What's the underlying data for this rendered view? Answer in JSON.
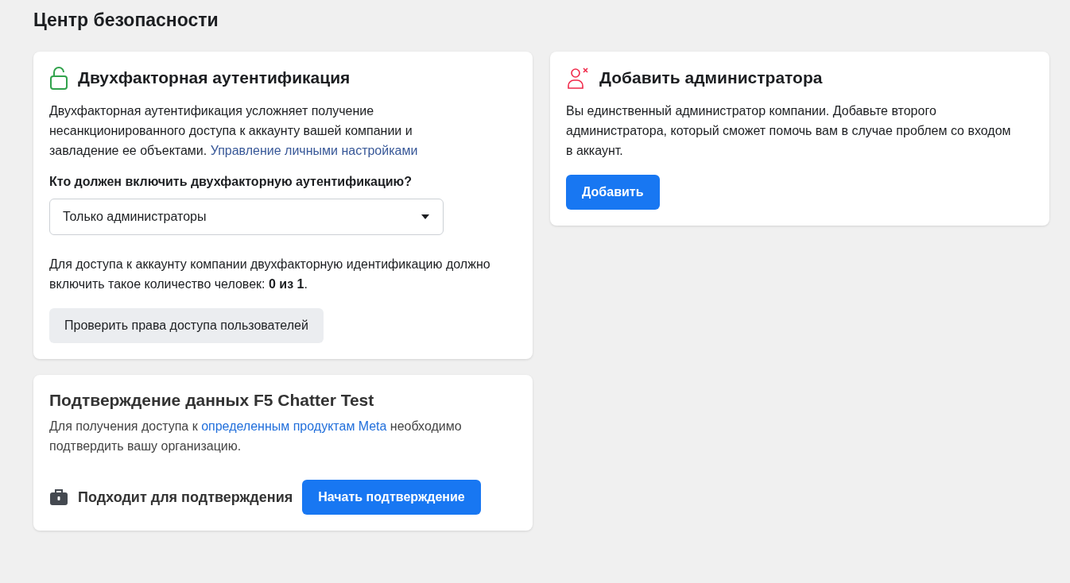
{
  "page_title": "Центр безопасности",
  "two_factor": {
    "title": "Двухфакторная аутентификация",
    "description": "Двухфакторная аутентификация усложняет получение несанкционированного доступа к аккаунту вашей компании и завладение ее объектами.",
    "link": "Управление личными настройками",
    "question": "Кто должен включить двухфакторную аутентификацию?",
    "select": {
      "value": "Только администраторы"
    },
    "status": "Для доступа к аккаунту компании двухфакторную идентификацию должно включить такое количество человек: **0 из 1**.",
    "button": "Проверить права доступа пользователей"
  },
  "verification": {
    "title": "Подтверждение данных F5 Chatter Test",
    "description_before": "Для получения доступа к",
    "link": "определенным продуктам Meta",
    "description_after": "необходимо подтвердить вашу организацию.",
    "eligibility": "Подходит для подтверждения",
    "button": "Начать подтверждение"
  },
  "add_admin": {
    "title": "Добавить администратора",
    "description": "Вы единственный администратор компании. Добавьте второго администратора, который сможет помочь вам в случае проблем со входом в аккаунт.",
    "button": "Добавить"
  }
}
